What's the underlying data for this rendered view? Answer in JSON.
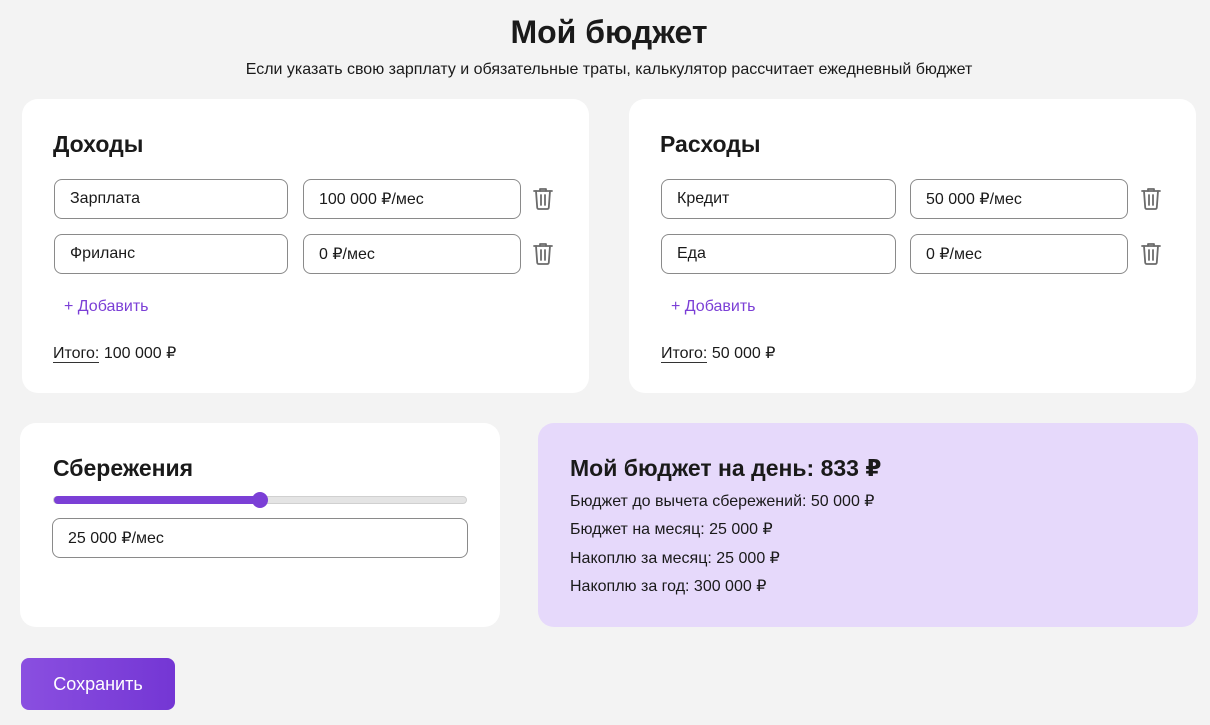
{
  "header": {
    "title": "Мой бюджет",
    "subtitle": "Если указать свою зарплату и обязательные траты, калькулятор рассчитает ежедневный бюджет"
  },
  "income": {
    "title": "Доходы",
    "items": [
      {
        "name": "Зарплата",
        "amount": "100 000 ₽/мес"
      },
      {
        "name": "Фриланс",
        "amount": "0 ₽/мес"
      }
    ],
    "add_label": "+ Добавить",
    "total_label": "Итого:",
    "total_value": "100 000 ₽"
  },
  "expenses": {
    "title": "Расходы",
    "items": [
      {
        "name": "Кредит",
        "amount": "50 000 ₽/мес"
      },
      {
        "name": "Еда",
        "amount": "0 ₽/мес"
      }
    ],
    "add_label": "+ Добавить",
    "total_label": "Итого:",
    "total_value": "50 000 ₽"
  },
  "savings": {
    "title": "Сбережения",
    "slider_fraction": 0.5,
    "amount": "25 000 ₽/мес"
  },
  "result": {
    "title": "Мой бюджет на день: 833 ₽",
    "lines": [
      "Бюджет до вычета сбережений: 50 000 ₽",
      "Бюджет на месяц: 25 000 ₽",
      "Накоплю за месяц: 25 000 ₽",
      "Накоплю за год: 300 000 ₽"
    ]
  },
  "actions": {
    "save_label": "Сохранить"
  },
  "icons": {
    "delete": "trash-icon"
  },
  "colors": {
    "accent": "#7b3fd6",
    "result_bg": "#e6d9fb",
    "page_bg": "#f3f3f3"
  }
}
